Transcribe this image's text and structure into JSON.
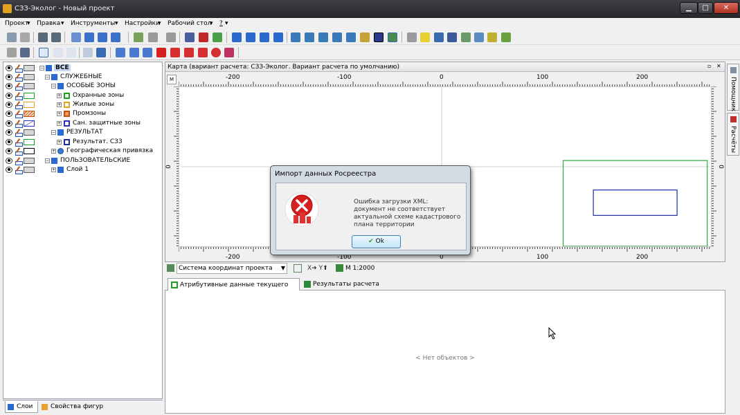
{
  "window": {
    "title": "СЗЗ-Эколог - Новый проект",
    "min": "▁",
    "max": "□",
    "close": "✕"
  },
  "menu": [
    {
      "label": "Проект"
    },
    {
      "label": "Правка"
    },
    {
      "label": "Инструменты"
    },
    {
      "label": "Настройки"
    },
    {
      "label": "Рабочий стол"
    },
    {
      "label": "?"
    }
  ],
  "tree": [
    {
      "label": "ВСЕ",
      "swatch": "#d8d8d8",
      "selected": true
    },
    {
      "label": "СЛУЖЕБНЫЕ",
      "swatch": "#d8d8d8"
    },
    {
      "label": "ОСОБЫЕ ЗОНЫ",
      "swatch": "#d8d8d8"
    },
    {
      "label": "Охранные зоны",
      "swatch": "#ffffff",
      "border": "#1aa01a"
    },
    {
      "label": "Жилые зоны",
      "swatch": "#ffffff",
      "border": "#e8a020"
    },
    {
      "label": "Промзоны",
      "swatch": "#f7d8b8",
      "border": "#c05010"
    },
    {
      "label": "Сан. защитные зоны",
      "swatch": "#ffffff",
      "border": "#3030c0"
    },
    {
      "label": "РЕЗУЛЬТАТ",
      "swatch": "#d8d8d8"
    },
    {
      "label": "Результат. СЗЗ",
      "swatch": "#ffffff",
      "border": "#1aa01a"
    },
    {
      "label": "Географическая привязка",
      "swatch": "#ffffff",
      "border": "#000000"
    },
    {
      "label": "ПОЛЬЗОВАТЕЛЬСКИЕ",
      "swatch": "#d8d8d8"
    },
    {
      "label": "Слой 1",
      "swatch": "#d8d8d8"
    }
  ],
  "left_tabs": {
    "layers": "Слои",
    "shape_props": "Свойства фигур"
  },
  "map": {
    "header": "Карта (вариант расчета: СЗЗ-Эколог. Вариант расчета по умолчанию)",
    "corner": "M",
    "x_ticks": [
      "-200",
      "-100",
      "0",
      "100",
      "200"
    ],
    "y_tick": "0"
  },
  "coord": {
    "system": "Система координат проекта",
    "xy": "X➜ Y⬆",
    "scale": "M 1:2000"
  },
  "attr_tabs": {
    "current_layer": "Атрибутивные данные текущего слоя",
    "results": "Результаты расчета"
  },
  "attr": {
    "empty": "< Нет объектов >"
  },
  "right_tabs": {
    "helper": "Помощник",
    "calcs": "Расчёты"
  },
  "dialog": {
    "title": "Импорт данных Росреестра",
    "message": "Ошибка загрузки XML: документ не соответствует актуальной схеме кадастрового плана территории",
    "ok": "Ok"
  },
  "colors": {
    "green_zone": "#22aa33",
    "blue_zone": "#1a2aa0",
    "error_red": "#d42020"
  }
}
